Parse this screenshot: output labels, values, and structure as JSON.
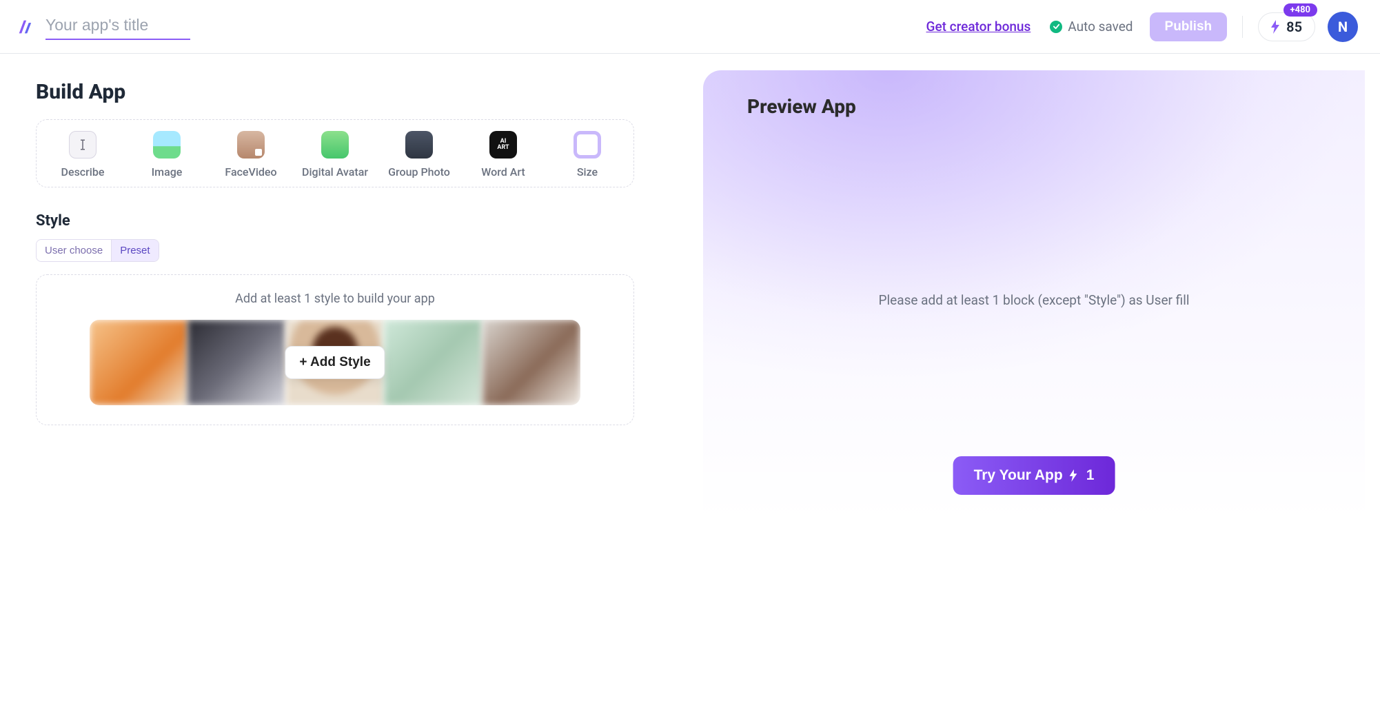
{
  "header": {
    "title_placeholder": "Your app's title",
    "creator_bonus": "Get creator bonus",
    "auto_saved": "Auto saved",
    "publish": "Publish",
    "credits_value": "85",
    "credits_plus": "+480",
    "avatar_initial": "N"
  },
  "build": {
    "title": "Build App",
    "blocks": [
      {
        "label": "Describe",
        "icon": "describe"
      },
      {
        "label": "Image",
        "icon": "image"
      },
      {
        "label": "FaceVideo",
        "icon": "facevideo"
      },
      {
        "label": "Digital Avatar",
        "icon": "avatar"
      },
      {
        "label": "Group Photo",
        "icon": "group"
      },
      {
        "label": "Word Art",
        "icon": "wordart"
      },
      {
        "label": "Size",
        "icon": "size"
      }
    ],
    "style": {
      "heading": "Style",
      "seg_user": "User choose",
      "seg_preset": "Preset",
      "hint": "Add at least 1 style to build your app",
      "add_style": "+ Add Style"
    }
  },
  "preview": {
    "title": "Preview App",
    "hint": "Please add at least 1 block (except \"Style\") as User fill",
    "try_label": "Try Your App",
    "try_cost": "1"
  }
}
